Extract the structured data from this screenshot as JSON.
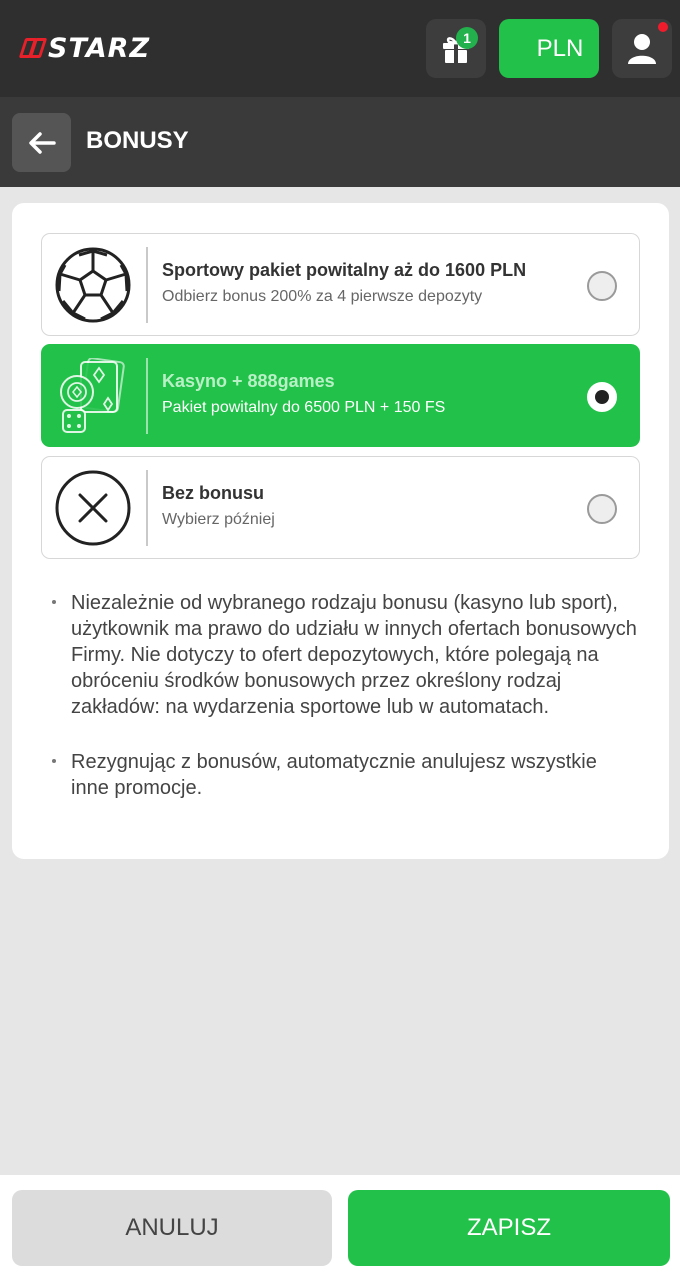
{
  "header": {
    "logo_text": "STARZ",
    "gift_badge": "1",
    "currency": "PLN",
    "user_notification": true
  },
  "page": {
    "title": "BONUSY"
  },
  "options": [
    {
      "icon": "soccer-ball-icon",
      "title": "Sportowy pakiet powitalny aż do 1600 PLN",
      "subtitle": "Odbierz bonus 200% za 4 pierwsze depozyty",
      "selected": false
    },
    {
      "icon": "casino-cards-chip-dice-icon",
      "title": "Kasyno + 888games",
      "subtitle": "Pakiet powitalny do 6500 PLN + 150 FS",
      "selected": true
    },
    {
      "icon": "circle-x-icon",
      "title": "Bez bonusu",
      "subtitle": "Wybierz później",
      "selected": false
    }
  ],
  "notes": [
    "Niezależnie od wybranego rodzaju bonusu (kasyno lub sport), użytkownik ma prawo do udziału w innych ofertach bonusowych Firmy. Nie dotyczy to ofert depozytowych, które polegają na obróceniu środków bonusowych przez określony rodzaj zakładów: na wydarzenia sportowe lub w automatach.",
    "Rezygnując z bonusów, automatycznie anulujesz wszystkie inne promocje."
  ],
  "footer": {
    "cancel_label": "ANULUJ",
    "save_label": "ZAPISZ"
  },
  "colors": {
    "accent_green": "#22c14a",
    "topbar": "#2f2f2f",
    "headerbar": "#3a3a3a",
    "logo_red": "#e8202a",
    "notification_red": "#f01c2c"
  }
}
